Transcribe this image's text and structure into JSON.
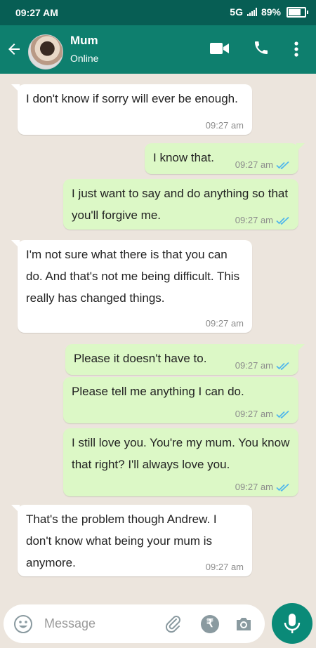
{
  "status_bar": {
    "time": "09:27 AM",
    "network": "5G",
    "battery": "89%"
  },
  "header": {
    "name": "Mum",
    "status": "Online"
  },
  "messages": [
    {
      "direction": "in",
      "text": "I don't know if sorry will ever be enough.",
      "time": "09:27 am"
    },
    {
      "direction": "out",
      "text": "I know that.",
      "time": "09:27 am",
      "read": true
    },
    {
      "direction": "out",
      "text": "I just want to say and do anything so that you'll forgive me.",
      "time": "09:27 am",
      "read": true
    },
    {
      "direction": "in",
      "text": "I'm not sure what there is that you can do. And that's not me being difficult. This really has changed things.",
      "time": "09:27 am"
    },
    {
      "direction": "out",
      "text": "Please it doesn't have to.",
      "time": "09:27 am",
      "read": true
    },
    {
      "direction": "out",
      "text": "Please tell me anything I can do.",
      "time": "09:27 am",
      "read": true
    },
    {
      "direction": "out",
      "text": "I still love you. You're my mum. You know that right? I'll always love you.",
      "time": "09:27 am",
      "read": true
    },
    {
      "direction": "in",
      "text": "That's the problem though Andrew. I don't know what being your mum is anymore.",
      "time": "09:27 am"
    }
  ],
  "input": {
    "placeholder": "Message",
    "rupee_symbol": "₹"
  },
  "icons": [
    "back-arrow-icon",
    "video-call-icon",
    "phone-icon",
    "more-vert-icon",
    "emoji-icon",
    "attach-icon",
    "rupee-icon",
    "camera-icon",
    "mic-icon",
    "double-tick-icon"
  ],
  "colors": {
    "header": "#0e7f6e",
    "status_bar": "#075e54",
    "outgoing": "#dcf8c6",
    "incoming": "#ffffff",
    "background": "#ece5dd",
    "read_ticks": "#4fb6ec",
    "mic_button": "#0a8a78"
  }
}
